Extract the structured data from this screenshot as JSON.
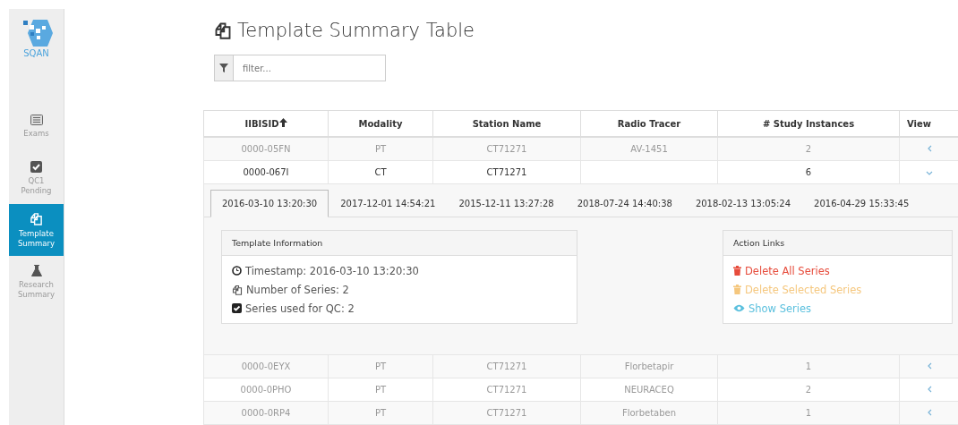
{
  "logo": {
    "text": "SQAN"
  },
  "sidebar": {
    "items": [
      {
        "label": "Exams",
        "kind": "list",
        "selected": false
      },
      {
        "label": "QC1 Pending",
        "kind": "check",
        "selected": false
      },
      {
        "label": "Template Summary",
        "kind": "copy",
        "selected": true
      },
      {
        "label": "Research Summary",
        "kind": "flask",
        "selected": false
      }
    ]
  },
  "title": "Template Summary Table",
  "filter": {
    "placeholder": "filter..."
  },
  "table": {
    "columns": [
      {
        "label": "IIBISID",
        "sorted": true
      },
      {
        "label": "Modality",
        "sorted": false
      },
      {
        "label": "Station Name",
        "sorted": false
      },
      {
        "label": "Radio Tracer",
        "sorted": false
      },
      {
        "label": "# Study Instances",
        "sorted": false
      },
      {
        "label": "View",
        "sorted": false
      }
    ],
    "rows": [
      {
        "cells": [
          "0000-05FN",
          "PT",
          "CT71271",
          "AV-1451",
          "2"
        ],
        "expanded": false
      },
      {
        "cells": [
          "0000-067I",
          "CT",
          "CT71271",
          "",
          "6"
        ],
        "expanded": true,
        "detail": {
          "tabs": [
            {
              "label": "2016-03-10 13:20:30",
              "selected": true
            },
            {
              "label": "2017-12-01 14:54:21",
              "selected": false
            },
            {
              "label": "2015-12-11 13:27:28",
              "selected": false
            },
            {
              "label": "2018-07-24 14:40:38",
              "selected": false
            },
            {
              "label": "2018-02-13 13:05:24",
              "selected": false
            },
            {
              "label": "2016-04-29 15:33:45",
              "selected": false
            }
          ],
          "info": {
            "title": "Template Information",
            "items": [
              {
                "kind": "clock",
                "text": "Timestamp: 2016-03-10 13:20:30"
              },
              {
                "kind": "copy",
                "text": "Number of Series: 2"
              },
              {
                "kind": "check",
                "text": "Series used for QC: 2"
              }
            ]
          },
          "actions": {
            "title": "Action Links",
            "items": [
              {
                "kind": "danger",
                "text": "Delete All Series"
              },
              {
                "kind": "warning",
                "text": "Delete Selected Series"
              },
              {
                "kind": "info",
                "text": "Show Series"
              }
            ]
          }
        }
      },
      {
        "cells": [
          "0000-0EYX",
          "PT",
          "CT71271",
          "Florbetapir",
          "1"
        ],
        "expanded": false
      },
      {
        "cells": [
          "0000-0PHO",
          "PT",
          "CT71271",
          "NEURACEQ",
          "2"
        ],
        "expanded": false
      },
      {
        "cells": [
          "0000-0RP4",
          "PT",
          "CT71271",
          "Florbetaben",
          "1"
        ],
        "expanded": false
      }
    ]
  }
}
